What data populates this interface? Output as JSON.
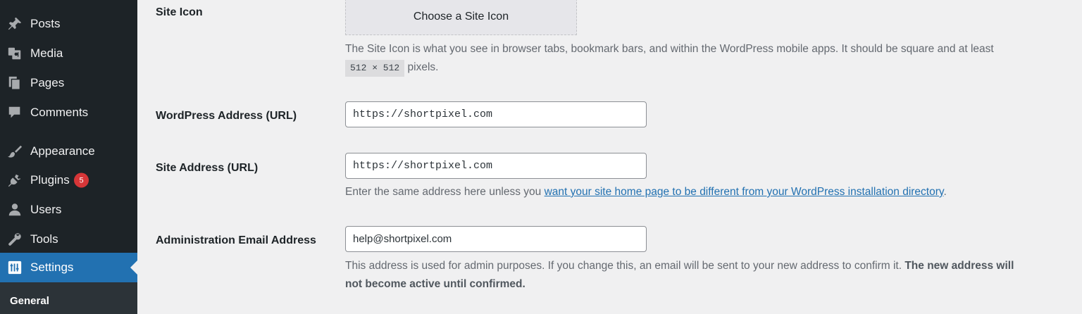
{
  "sidebar": {
    "items": [
      {
        "label": "Posts",
        "icon": "pin-icon"
      },
      {
        "label": "Media",
        "icon": "media-icon"
      },
      {
        "label": "Pages",
        "icon": "pages-icon"
      },
      {
        "label": "Comments",
        "icon": "comment-icon"
      },
      {
        "label": "Appearance",
        "icon": "brush-icon"
      },
      {
        "label": "Plugins",
        "icon": "plug-icon",
        "badge": "5"
      },
      {
        "label": "Users",
        "icon": "user-icon"
      },
      {
        "label": "Tools",
        "icon": "wrench-icon"
      },
      {
        "label": "Settings",
        "icon": "settings-icon",
        "active": true
      }
    ],
    "submenu": {
      "label": "General"
    }
  },
  "settings": {
    "site_icon": {
      "label": "Site Icon",
      "button": "Choose a Site Icon",
      "desc_line1": "The Site Icon is what you see in browser tabs, bookmark bars, and within the WordPress mobile apps. It should be square and at least",
      "size_code": "512 × 512",
      "desc_line2_suffix": "pixels."
    },
    "wp_address": {
      "label": "WordPress Address (URL)",
      "value": "https://shortpixel.com"
    },
    "site_address": {
      "label": "Site Address (URL)",
      "value": "https://shortpixel.com",
      "desc_prefix": "Enter the same address here unless you",
      "desc_link": "want your site home page to be different from your WordPress installation directory",
      "desc_suffix": "."
    },
    "admin_email": {
      "label": "Administration Email Address",
      "value": "help@shortpixel.com",
      "desc_line1_normal": "This address is used for admin purposes. If you change this, an email will be sent to your new address to confirm it.",
      "desc_line1_bold": "The new address will",
      "desc_line2_bold": "not become active until confirmed."
    }
  },
  "colors": {
    "sidebar_bg": "#1d2327",
    "accent": "#2271b1",
    "badge": "#d63638",
    "page_bg": "#f0f0f1"
  }
}
